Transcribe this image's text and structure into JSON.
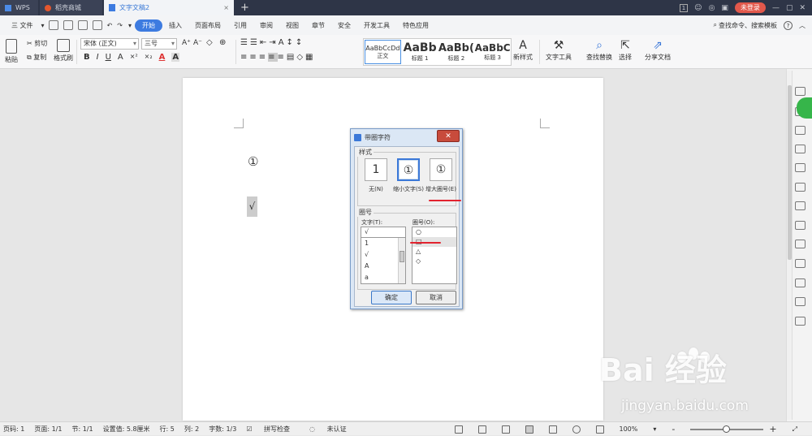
{
  "titlebar": {
    "tabs": [
      {
        "label": "WPS"
      },
      {
        "label": "稻壳商城"
      },
      {
        "label": "文字文稿2"
      }
    ],
    "new_tab": "+",
    "badge": "1",
    "login": "未登录"
  },
  "menubar": {
    "file": "三 文件",
    "items": [
      "开始",
      "插入",
      "页面布局",
      "引用",
      "审阅",
      "视图",
      "章节",
      "安全",
      "开发工具",
      "特色应用"
    ],
    "search": "查找命令、搜索模板",
    "help": "?"
  },
  "ribbon": {
    "paste": "粘贴",
    "cut": "剪切",
    "copy": "复制",
    "format_painter": "格式刷",
    "font_name": "宋体 (正文)",
    "font_size": "三号",
    "format_buttons": [
      "B",
      "I",
      "U",
      "A",
      "×²",
      "×₂",
      "A",
      "A"
    ],
    "styles": [
      {
        "preview": "AaBbCcDd",
        "label": "正文"
      },
      {
        "preview": "AaBb",
        "label": "标题 1"
      },
      {
        "preview": "AaBb(",
        "label": "标题 2"
      },
      {
        "preview": "AaBbC",
        "label": "标题 3"
      }
    ],
    "new_style": "新样式",
    "text_tools": "文字工具",
    "find_replace": "查找替换",
    "select": "选择",
    "share": "分享文档"
  },
  "document": {
    "circle_char": "①",
    "check_char": "√"
  },
  "dialog": {
    "title": "带圈字符",
    "close": "✕",
    "style_group": "样式",
    "style_options": [
      {
        "preview": "1",
        "label": "无(N)"
      },
      {
        "preview": "①",
        "label": "缩小文字(S)"
      },
      {
        "preview": "①",
        "label": "增大圈号(E)"
      }
    ],
    "circle_group": "圈号",
    "text_label": "文字(T):",
    "text_input": "√",
    "text_list": [
      "1",
      "√",
      "A",
      "a"
    ],
    "enclosure_label": "圈号(O):",
    "enclosure_list": [
      "○",
      "□",
      "△",
      "◇"
    ],
    "ok": "确定",
    "cancel": "取消"
  },
  "statusbar": {
    "items": [
      "页码: 1",
      "页面: 1/1",
      "节: 1/1",
      "设置值: 5.8厘米",
      "行: 5",
      "列: 2",
      "字数: 1/3",
      "拼写检查",
      "未认证"
    ],
    "zoom": "100%",
    "zoom_minus": "-",
    "zoom_plus": "+"
  },
  "watermark": {
    "brand": "Bai 经验",
    "url": "jingyan.baidu.com"
  }
}
